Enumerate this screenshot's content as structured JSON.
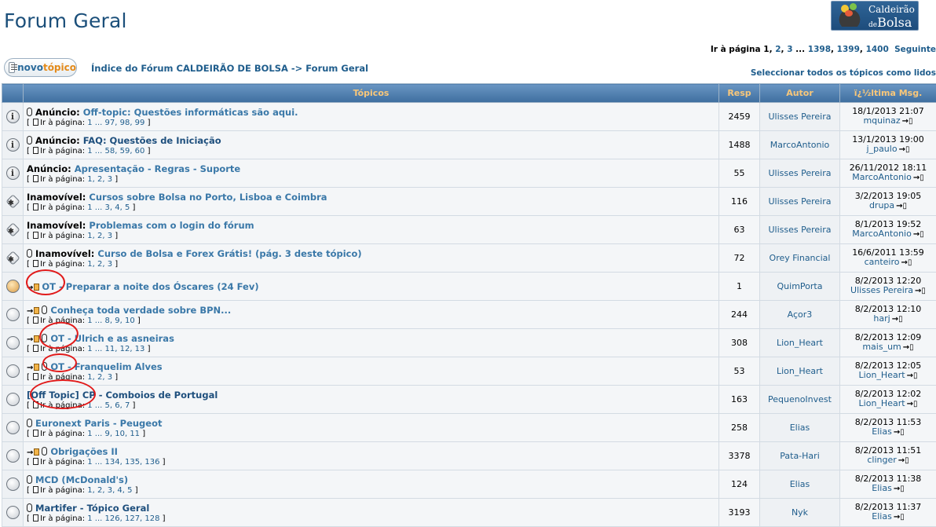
{
  "page": {
    "title": "Forum Geral",
    "logo": {
      "line1": "Caldeirão",
      "line2_small": "de",
      "line2": "Bolsa"
    },
    "pager": {
      "prefix": "Ir à página ",
      "current": "1",
      "links": [
        "2",
        "3"
      ],
      "ellipsis": " ... ",
      "tail_links": [
        "1398",
        "1399",
        "1400"
      ],
      "next": "Seguinte"
    },
    "new_topic": {
      "part1": "novo",
      "part2": "tópico"
    },
    "breadcrumb": "Índice do Fórum CALDEIRÃO DE BOLSA -> Forum Geral",
    "mark_read": "Seleccionar todos os tópicos como lidos"
  },
  "table": {
    "headers": {
      "topics": "Tópicos",
      "replies": "Resp",
      "author": "Autor",
      "last": "ï¿½ltima Msg."
    },
    "rows": [
      {
        "icon": "announce",
        "clip": true,
        "arrow": false,
        "label": "Anúncio: ",
        "title": "Off-topic: Questões informáticas são aqui.",
        "title_bold": false,
        "pages": "1 ... 97, 98, 99",
        "replies": "2459",
        "author": "Ulisses Pereira",
        "last_date": "18/1/2013 21:07",
        "last_user": "mquinaz"
      },
      {
        "icon": "announce",
        "clip": true,
        "arrow": false,
        "label": "Anúncio: ",
        "title": "FAQ: Questões de Iniciação",
        "title_bold": true,
        "pages": "1 ... 58, 59, 60",
        "replies": "1488",
        "author": "MarcoAntonio",
        "last_date": "13/1/2013 19:00",
        "last_user": "j_paulo"
      },
      {
        "icon": "announce",
        "clip": false,
        "arrow": false,
        "label": "Anúncio: ",
        "title": "Apresentação - Regras - Suporte",
        "title_bold": false,
        "pages": "1, 2, 3",
        "replies": "55",
        "author": "Ulisses Pereira",
        "last_date": "26/11/2012 18:11",
        "last_user": "MarcoAntonio"
      },
      {
        "icon": "sticky",
        "clip": false,
        "arrow": false,
        "label": "Inamovível: ",
        "title": "Cursos sobre Bolsa no Porto, Lisboa e Coimbra",
        "title_bold": false,
        "pages": "1 ... 3, 4, 5",
        "replies": "116",
        "author": "Ulisses Pereira",
        "last_date": "3/2/2013 19:05",
        "last_user": "drupa"
      },
      {
        "icon": "sticky",
        "clip": false,
        "arrow": false,
        "label": "Inamovível: ",
        "title": "Problemas com o login do fórum",
        "title_bold": false,
        "pages": "1, 2, 3",
        "replies": "63",
        "author": "Ulisses Pereira",
        "last_date": "8/1/2013 19:52",
        "last_user": "MarcoAntonio"
      },
      {
        "icon": "sticky",
        "clip": true,
        "arrow": false,
        "label": "Inamovível: ",
        "title": "Curso de Bolsa e Forex Grátis! (pág. 3 deste tópico)",
        "title_bold": false,
        "pages": "1, 2, 3",
        "replies": "72",
        "author": "Orey Financial",
        "last_date": "16/6/2011 13:59",
        "last_user": "canteiro"
      },
      {
        "icon": "hot",
        "clip": false,
        "arrow": true,
        "label": "",
        "title": "OT - Preparar a noite dos Óscares (24 Fev)",
        "title_bold": false,
        "pages": "",
        "replies": "1",
        "author": "QuimPorta",
        "last_date": "8/2/2013 12:20",
        "last_user": "Ulisses Pereira"
      },
      {
        "icon": "normal",
        "clip": true,
        "arrow": true,
        "label": "",
        "title": "Conheça toda verdade sobre BPN...",
        "title_bold": false,
        "pages": "1 ... 8, 9, 10",
        "replies": "244",
        "author": "Açor3",
        "last_date": "8/2/2013 12:10",
        "last_user": "harj"
      },
      {
        "icon": "normal",
        "clip": true,
        "arrow": true,
        "label": "",
        "title": "OT - Ulrich e as asneiras",
        "title_bold": false,
        "pages": "1 ... 11, 12, 13",
        "replies": "308",
        "author": "Lion_Heart",
        "last_date": "8/2/2013 12:09",
        "last_user": "mais_um"
      },
      {
        "icon": "normal",
        "clip": true,
        "arrow": true,
        "label": "",
        "title": "OT - Franquelim Alves",
        "title_bold": false,
        "pages": "1, 2, 3",
        "replies": "53",
        "author": "Lion_Heart",
        "last_date": "8/2/2013 12:05",
        "last_user": "Lion_Heart"
      },
      {
        "icon": "normal",
        "clip": false,
        "arrow": false,
        "label": "",
        "title": "[Off Topic] CP - Comboios de Portugal",
        "title_bold": true,
        "pages": "1 ... 5, 6, 7",
        "replies": "163",
        "author": "PequenoInvest",
        "last_date": "8/2/2013 12:02",
        "last_user": "Lion_Heart"
      },
      {
        "icon": "normal",
        "clip": true,
        "arrow": false,
        "label": "",
        "title": "Euronext Paris - Peugeot",
        "title_bold": false,
        "pages": "1 ... 9, 10, 11",
        "replies": "258",
        "author": "Elias",
        "last_date": "8/2/2013 11:53",
        "last_user": "Elias"
      },
      {
        "icon": "normal",
        "clip": true,
        "arrow": true,
        "label": "",
        "title": "Obrigações II",
        "title_bold": false,
        "pages": "1 ... 134, 135, 136",
        "replies": "3378",
        "author": "Pata-Hari",
        "last_date": "8/2/2013 11:51",
        "last_user": "clinger"
      },
      {
        "icon": "normal",
        "clip": true,
        "arrow": false,
        "label": "",
        "title": "MCD (McDonald's)",
        "title_bold": false,
        "pages": "1, 2, 3, 4, 5",
        "replies": "124",
        "author": "Elias",
        "last_date": "8/2/2013 11:38",
        "last_user": "Elias"
      },
      {
        "icon": "normal",
        "clip": true,
        "arrow": false,
        "label": "",
        "title": "Martifer - Tópico Geral",
        "title_bold": true,
        "pages": "1 ... 126, 127, 128",
        "replies": "3193",
        "author": "Nyk",
        "last_date": "8/2/2013 11:37",
        "last_user": "Elias"
      }
    ],
    "page_prefix": "Ir à página: "
  },
  "annotations": {
    "circle_color": "#e11a1a",
    "circles": 4
  }
}
